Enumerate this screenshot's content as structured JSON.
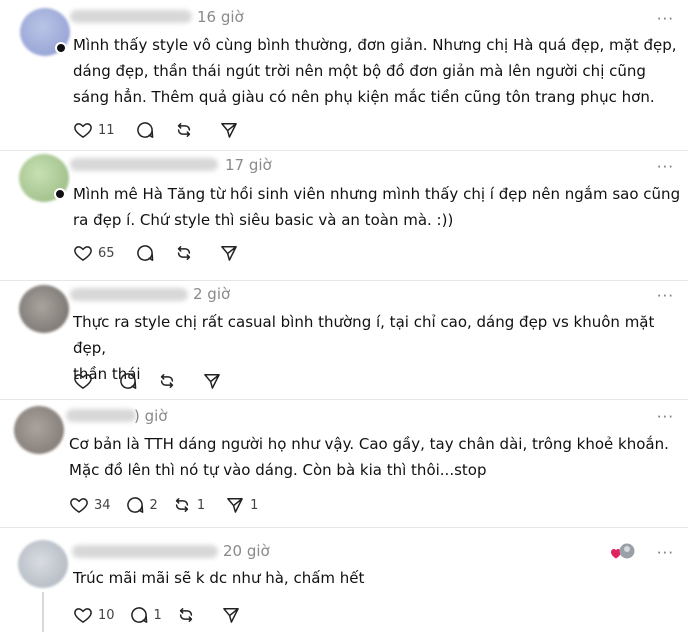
{
  "comments": [
    {
      "time": "16 giờ",
      "text": "Mình thấy style vô cùng bình thường, đơn giản. Nhưng chị Hà quá đẹp, mặt đẹp,\ndáng đẹp, thần thái ngút trời nên một bộ đồ đơn giản mà lên người chị cũng\nsáng hẳn. Thêm quả giàu có nên phụ kiện mắc tiền cũng tôn trang phục hơn.",
      "likes": "11",
      "replies": "",
      "reposts": ""
    },
    {
      "time": "17 giờ",
      "text": "Mình mê Hà Tăng từ hồi sinh viên nhưng mình thấy chị í đẹp nên ngắm sao cũng\nra đẹp í. Chứ style thì siêu basic và an toàn mà. :))",
      "likes": "65",
      "replies": "",
      "reposts": ""
    },
    {
      "time": "2 giờ",
      "text": "Thực ra style chị rất casual bình thường í, tại chỉ cao, dáng đẹp vs khuôn mặt đẹp,\nthần thái",
      "likes": "",
      "replies": "",
      "reposts": ""
    },
    {
      "time": ") giờ",
      "text": "Cơ bản là TTH dáng người họ như vậy. Cao gầy, tay chân dài, trông khoẻ khoắn.\nMặc đồ lên thì nó tự vào dáng. Còn bà kia thì thôi...stop",
      "likes": "34",
      "replies": "2",
      "reposts": "1"
    },
    {
      "time": "20 giờ",
      "text": "Trúc mãi mãi sẽ k dc như hà, chấm hết",
      "likes": "10",
      "replies": "1",
      "reposts": ""
    }
  ],
  "more_label": "···",
  "colors": {
    "heart_reaction": "#e0245e",
    "divider": "#e6e6e6",
    "muted": "#8a8a8a"
  },
  "icons": [
    "heart-icon",
    "comment-icon",
    "repost-icon",
    "share-icon",
    "more-icon"
  ]
}
